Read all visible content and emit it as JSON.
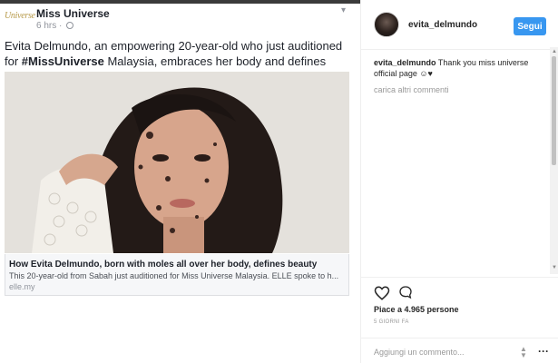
{
  "fb_post": {
    "logo_text": "Miss Universe",
    "page_name": "Miss Universe",
    "time": "6 hrs",
    "text_before": "Evita Delmundo, an empowering 20-year-old who just auditioned for ",
    "hashtag": "#MissUniverse",
    "text_after": " Malaysia, embraces her body and defines beauty.",
    "link_title": "How Evita Delmundo, born with moles all over her body, defines beauty",
    "link_desc": "This 20-year-old from Sabah just auditioned for Miss Universe Malaysia. ELLE spoke to h...",
    "link_domain": "elle.my"
  },
  "instagram": {
    "username": "evita_delmundo",
    "follow_label": "Segui",
    "comments": [
      {
        "user": "evita_delmundo",
        "text": "Thank you miss universe official page ☺♥"
      }
    ],
    "load_more": "carica altri commenti",
    "likes": "Piace a 4.965 persone",
    "date": "5 GIORNI FA",
    "add_comment_placeholder": "Aggiungi un commento..."
  },
  "icons": {
    "heart": "heart-icon",
    "comment": "comment-icon",
    "more": "more-icon",
    "globe": "globe-icon",
    "chevron": "chevron-down-icon"
  },
  "colors": {
    "follow_button": "#3897f0",
    "fb_text": "#1d2129",
    "muted": "#999999"
  }
}
